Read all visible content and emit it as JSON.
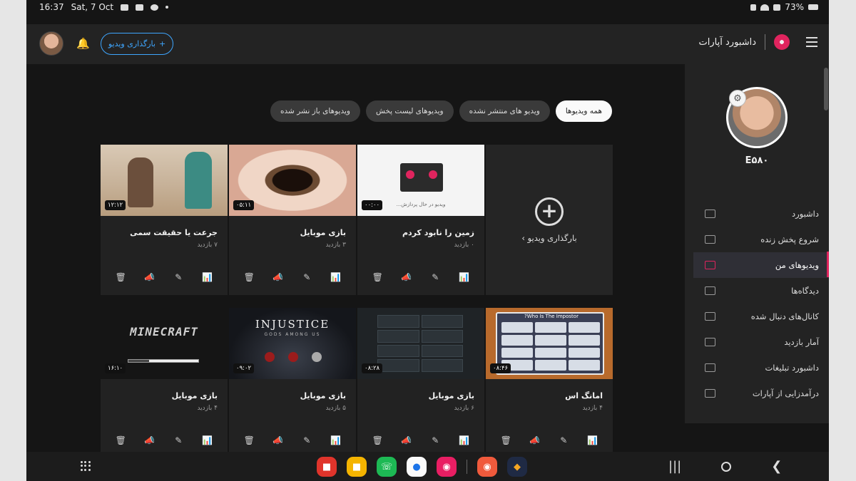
{
  "status_bar": {
    "time": "16:37",
    "date": "Sat, 7 Oct",
    "battery": "73%"
  },
  "header": {
    "brand_title": "داشبورد آپارات",
    "upload_button": "بارگذاری ویدیو",
    "upload_plus": "+"
  },
  "sidebar": {
    "username": "E۵۸۰",
    "items": [
      {
        "label": "داشبورد",
        "icon": "dashboard-icon",
        "active": false
      },
      {
        "label": "شروع پخش زنده",
        "icon": "live-stream-icon",
        "active": false
      },
      {
        "label": "ویدیوهای من",
        "icon": "my-videos-icon",
        "active": true
      },
      {
        "label": "دیدگاه‌ها",
        "icon": "comments-icon",
        "active": false
      },
      {
        "label": "کانال‌های دنبال شده",
        "icon": "followed-channels-icon",
        "active": false
      },
      {
        "label": "آمار بازدید",
        "icon": "stats-icon",
        "active": false
      },
      {
        "label": "داشبورد تبلیغات",
        "icon": "ads-icon",
        "active": false
      },
      {
        "label": "درآمدزایی از آپارات",
        "icon": "monetization-icon",
        "active": false
      }
    ]
  },
  "tabs": [
    {
      "label": "همه ویدیوها",
      "active": true
    },
    {
      "label": "ویدیو های منتشر نشده",
      "active": false
    },
    {
      "label": "ویدیوهای لیست پخش",
      "active": false
    },
    {
      "label": "ویدیوهای باز نشر شده",
      "active": false
    }
  ],
  "upload_card": {
    "label": "بارگذاری ویدیو ›",
    "plus": "+"
  },
  "videos": [
    {
      "title": "زمین را نابود کردم",
      "views": "۰ بازدید",
      "duration": "۰۰:۰۰",
      "processing_text": "ویدیو در حال پردازش..."
    },
    {
      "title": "بازی موبایل",
      "views": "۳ بازدید",
      "duration": "۰۵:۱۱"
    },
    {
      "title": "جرعت یا حقیقت سمی",
      "views": "۷ بازدید",
      "duration": "۱۲:۱۲"
    },
    {
      "title": "امانگ اس",
      "views": "۴ بازدید",
      "duration": "۰۸:۴۶",
      "thumb_header": "Who Is The Impostor?"
    },
    {
      "title": "بازی موبایل",
      "views": "۶ بازدید",
      "duration": "۰۸:۲۸"
    },
    {
      "title": "بازی موبایل",
      "views": "۵ بازدید",
      "duration": "۰۹:۰۲",
      "thumb_title": "INJUSTICE",
      "thumb_subtitle": "GODS AMONG US"
    },
    {
      "title": "بازی موبایل",
      "views": "۴ بازدید",
      "duration": "۱۶:۱۰",
      "thumb_title": "MINECRAFT",
      "load_progress": 0.7
    }
  ],
  "colors": {
    "accent": "#e0245e",
    "link": "#3ea6ff",
    "background": "#151515",
    "panel": "#232323"
  }
}
